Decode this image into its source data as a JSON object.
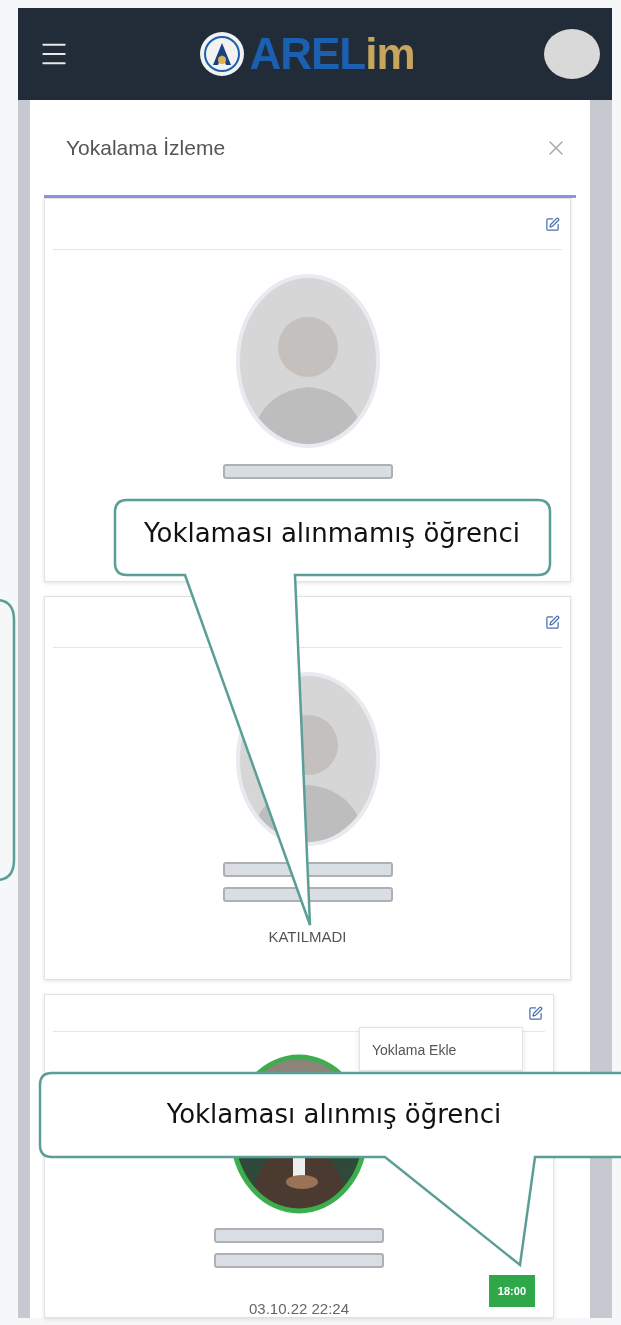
{
  "app_bar": {
    "logo_text": "AREL",
    "logo_accent": "im"
  },
  "modal": {
    "title": "Yokalama İzleme"
  },
  "students": [
    {
      "attended": false,
      "lines": [
        {
          "kind": "redacted"
        }
      ]
    },
    {
      "attended": false,
      "lines": [
        {
          "kind": "redacted"
        },
        {
          "kind": "redacted"
        }
      ],
      "status": "KATILMADI"
    },
    {
      "attended": true,
      "lines": [
        {
          "kind": "redacted"
        },
        {
          "kind": "redacted"
        }
      ],
      "date": "03.10.22 22:24",
      "time": "18:00",
      "menu": {
        "items": [
          "Yoklama Ekle"
        ]
      }
    }
  ],
  "callouts": [
    {
      "text": "Yoklaması alınmamış öğrenci"
    },
    {
      "text": "Yoklaması alınmış öğrenci"
    }
  ]
}
